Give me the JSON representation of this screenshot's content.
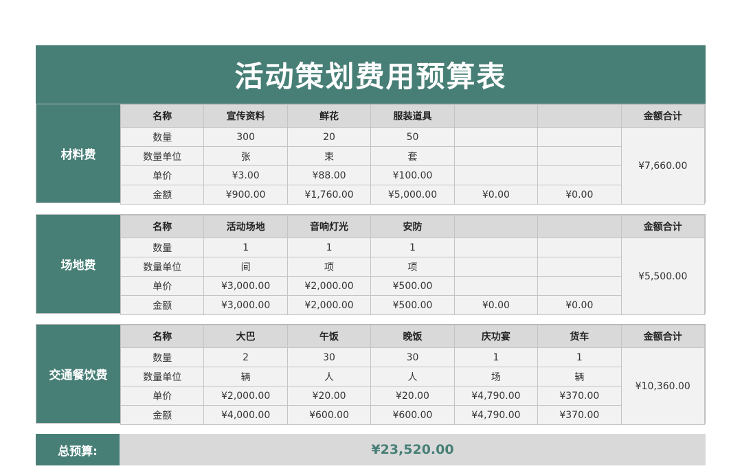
{
  "title": "活动策划费用预算表",
  "colors": {
    "accent": "#477f76",
    "header_gray": "#d9d9d9",
    "cell_gray": "#f2f2f2"
  },
  "sections": [
    {
      "label": "材料费",
      "headers": [
        "名称",
        "宣传资料",
        "鲜花",
        "服装道具",
        "",
        "",
        "金额合计"
      ],
      "rows": [
        {
          "label": "数量",
          "cells": [
            "300",
            "20",
            "50",
            "",
            ""
          ]
        },
        {
          "label": "数量单位",
          "cells": [
            "张",
            "束",
            "套",
            "",
            ""
          ]
        },
        {
          "label": "单价",
          "cells": [
            "¥3.00",
            "¥88.00",
            "¥100.00",
            "",
            ""
          ]
        },
        {
          "label": "金额",
          "cells": [
            "¥900.00",
            "¥1,760.00",
            "¥5,000.00",
            "¥0.00",
            "¥0.00"
          ]
        }
      ],
      "total": "¥7,660.00"
    },
    {
      "label": "场地费",
      "headers": [
        "名称",
        "活动场地",
        "音响灯光",
        "安防",
        "",
        "",
        "金额合计"
      ],
      "rows": [
        {
          "label": "数量",
          "cells": [
            "1",
            "1",
            "1",
            "",
            ""
          ]
        },
        {
          "label": "数量单位",
          "cells": [
            "间",
            "项",
            "项",
            "",
            ""
          ]
        },
        {
          "label": "单价",
          "cells": [
            "¥3,000.00",
            "¥2,000.00",
            "¥500.00",
            "",
            ""
          ]
        },
        {
          "label": "金额",
          "cells": [
            "¥3,000.00",
            "¥2,000.00",
            "¥500.00",
            "¥0.00",
            "¥0.00"
          ]
        }
      ],
      "total": "¥5,500.00"
    },
    {
      "label": "交通餐饮费",
      "headers": [
        "名称",
        "大巴",
        "午饭",
        "晚饭",
        "庆功宴",
        "货车",
        "金额合计"
      ],
      "rows": [
        {
          "label": "数量",
          "cells": [
            "2",
            "30",
            "30",
            "1",
            "1"
          ]
        },
        {
          "label": "数量单位",
          "cells": [
            "辆",
            "人",
            "人",
            "场",
            "辆"
          ]
        },
        {
          "label": "单价",
          "cells": [
            "¥2,000.00",
            "¥20.00",
            "¥20.00",
            "¥4,790.00",
            "¥370.00"
          ]
        },
        {
          "label": "金额",
          "cells": [
            "¥4,000.00",
            "¥600.00",
            "¥600.00",
            "¥4,790.00",
            "¥370.00"
          ]
        }
      ],
      "total": "¥10,360.00"
    }
  ],
  "grand_total": {
    "label": "总预算:",
    "value": "¥23,520.00"
  }
}
